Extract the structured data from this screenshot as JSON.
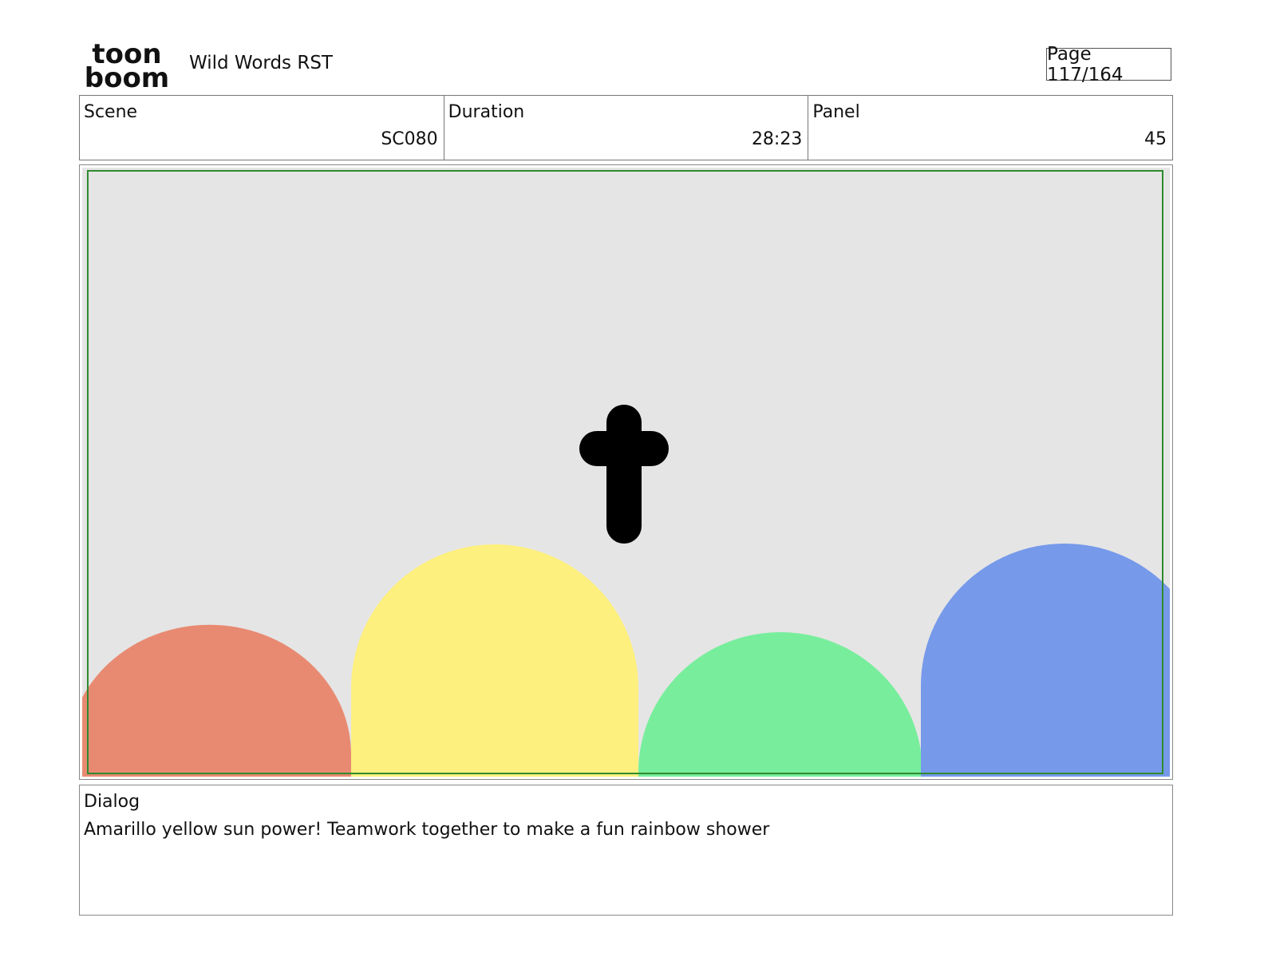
{
  "header": {
    "logo_top": "toon",
    "logo_bottom": "boom",
    "project_title": "Wild Words RST",
    "page_label": "Page 117/164"
  },
  "info": {
    "scene_label": "Scene",
    "scene_value": "SC080",
    "duration_label": "Duration",
    "duration_value": "28:23",
    "panel_label": "Panel",
    "panel_value": "45"
  },
  "panel": {
    "background_color": "#e5e5e5",
    "safe_frame_color": "#2e8b2e",
    "shape_colors": {
      "red": "#e88a72",
      "yellow": "#fef07e",
      "green": "#78ee9c",
      "blue": "#7699ea",
      "letter": "#000000"
    }
  },
  "dialog": {
    "label": "Dialog",
    "text": "Amarillo yellow sun power! Teamwork together to make a fun rainbow shower"
  }
}
